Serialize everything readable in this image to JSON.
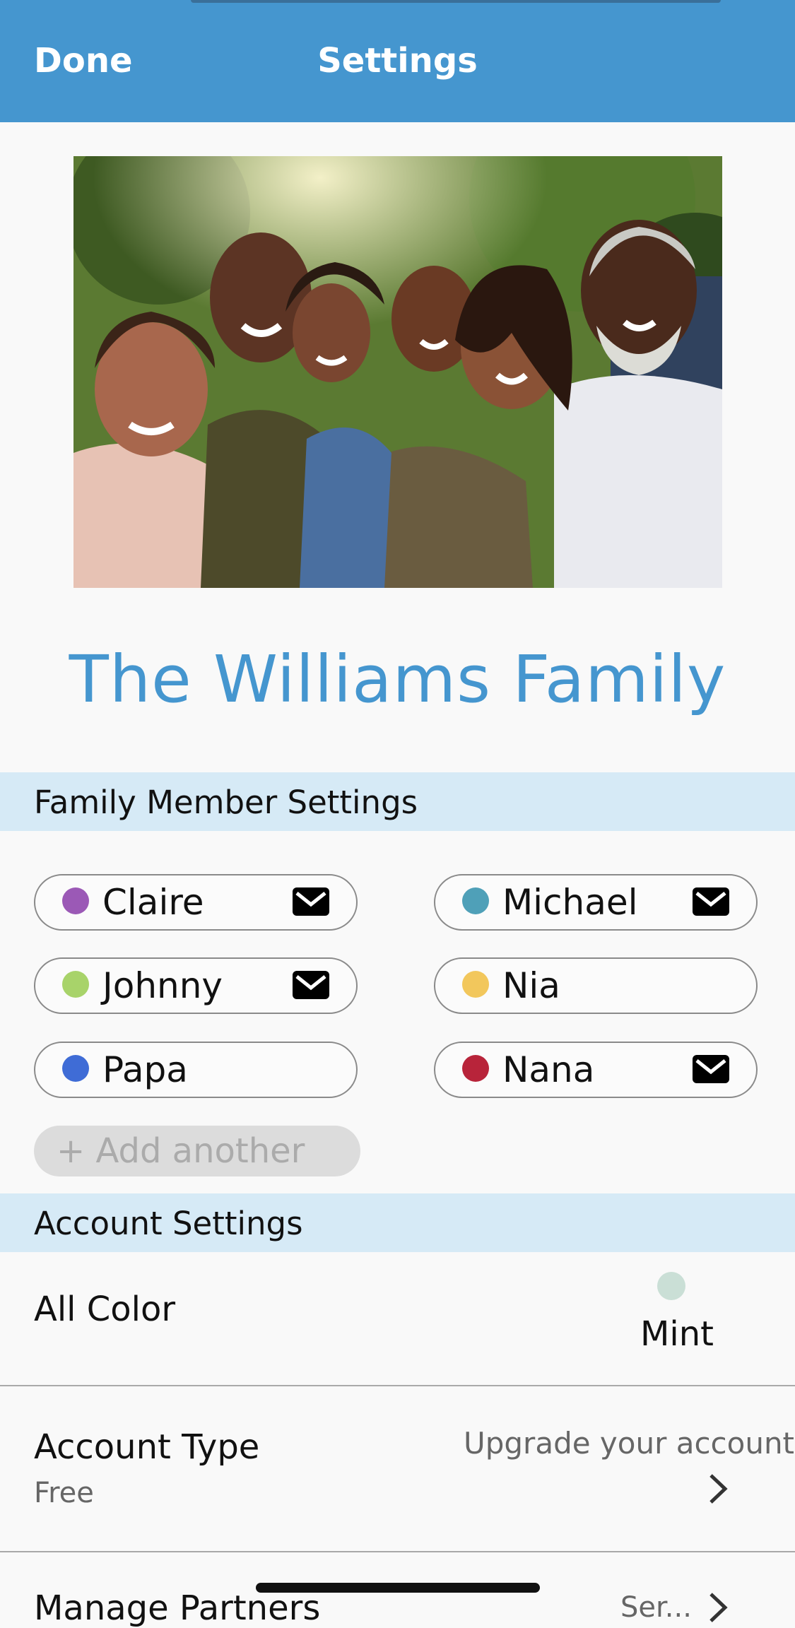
{
  "header": {
    "done_label": "Done",
    "title": "Settings"
  },
  "family": {
    "name": "The Williams Family",
    "photo_alt": "family photo"
  },
  "sections": {
    "members_title": "Family Member Settings",
    "account_title": "Account Settings"
  },
  "members": [
    {
      "name": "Claire",
      "color": "#9b59b6",
      "has_email": true
    },
    {
      "name": "Michael",
      "color": "#4fa0b8",
      "has_email": true
    },
    {
      "name": "Johnny",
      "color": "#a8d36a",
      "has_email": true
    },
    {
      "name": "Nia",
      "color": "#f2c75c",
      "has_email": false
    },
    {
      "name": "Papa",
      "color": "#3f6cd6",
      "has_email": false
    },
    {
      "name": "Nana",
      "color": "#b8243a",
      "has_email": true
    }
  ],
  "add_another_label": "+ Add another",
  "account": {
    "all_color_label": "All Color",
    "all_color_value": "Mint",
    "all_color_swatch": "#cadfd6",
    "account_type_label": "Account Type",
    "account_type_value": "Free",
    "upgrade_label": "Upgrade your account",
    "manage_partners_label": "Manage Partners",
    "manage_partners_value": "Ser..."
  },
  "colors": {
    "header_bg": "#4596cf",
    "section_bg": "#d6eaf6",
    "accent": "#4596cf"
  }
}
